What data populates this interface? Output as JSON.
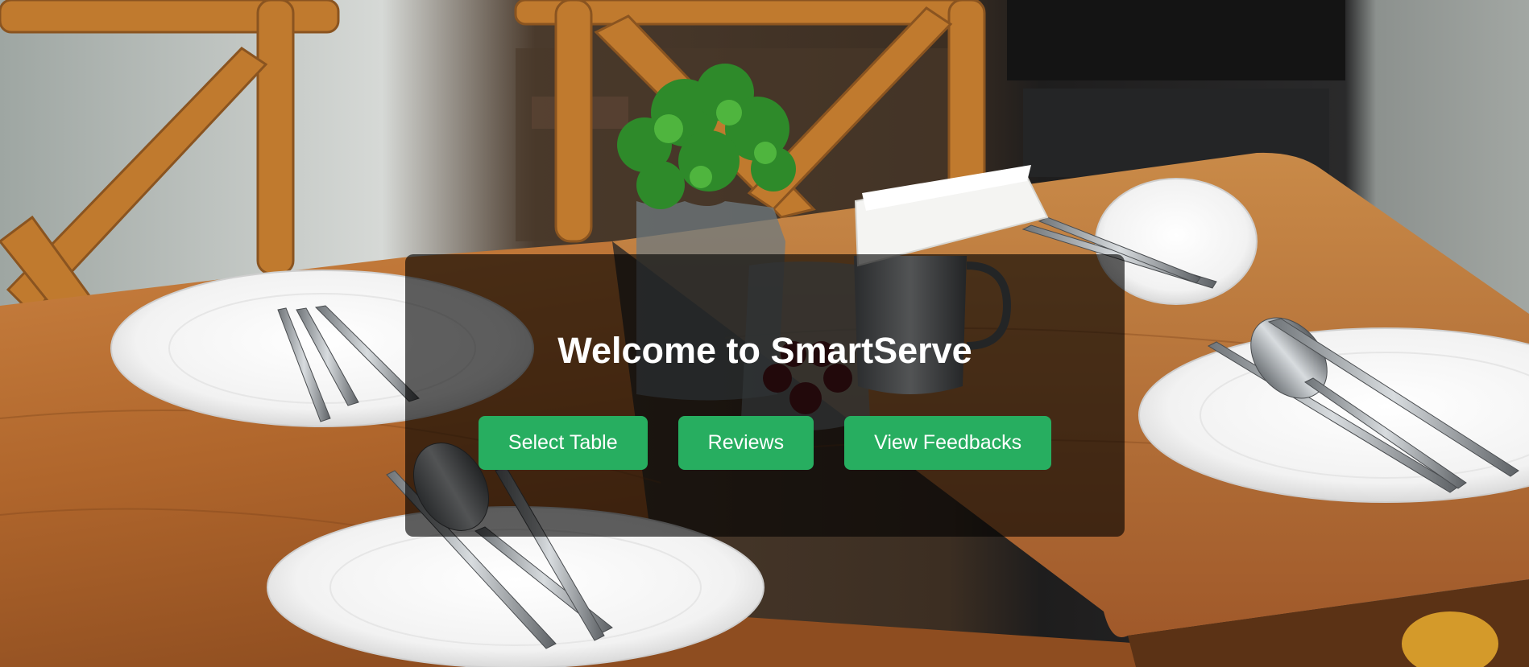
{
  "hero": {
    "title": "Welcome to SmartServe",
    "background_image": "restaurant-table-with-plates-cutlery-plant-photo"
  },
  "actions": {
    "select_table_label": "Select Table",
    "reviews_label": "Reviews",
    "view_feedbacks_label": "View Feedbacks"
  },
  "colors": {
    "button": "#27ae60",
    "button_text": "#ffffff",
    "overlay": "rgba(0,0,0,0.62)",
    "title": "#ffffff"
  }
}
